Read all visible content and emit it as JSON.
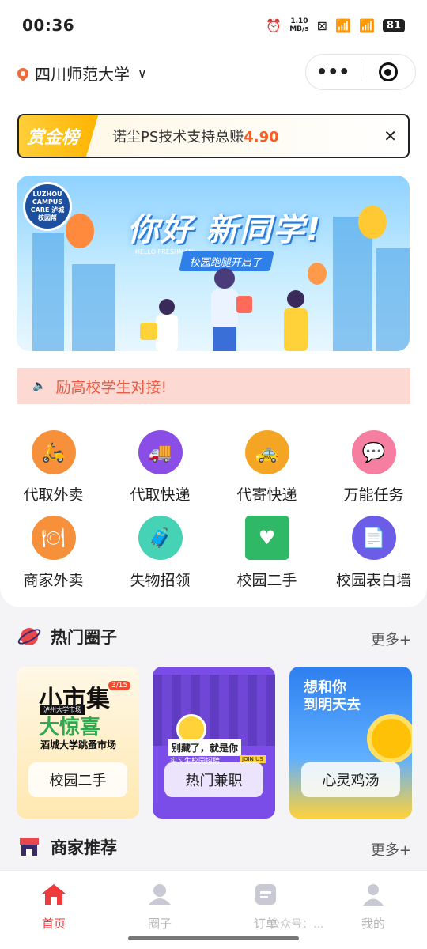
{
  "status": {
    "time": "00:36",
    "speed": "1.10\nMB/s",
    "speed_top": "1.10",
    "speed_bottom": "MB/s",
    "battery": "81"
  },
  "header": {
    "school": "四川师范大学"
  },
  "bounty": {
    "tag": "赏金榜",
    "text": "诺尘PS技术支持总赚",
    "amount": "4.90"
  },
  "banner": {
    "title": "你好 新同学!",
    "subtitle": "校园跑腿开启了",
    "hello": "HELLO FRESHMAN!",
    "logo": "LUZHOU CAMPUS CARE 泸城校园帮"
  },
  "notice": {
    "text": "励高校学生对接!"
  },
  "services": [
    {
      "label": "代取外卖",
      "icon": "takeout-icon",
      "color": "#f7903a"
    },
    {
      "label": "代取快递",
      "icon": "truck-icon",
      "color": "#8a4ee6"
    },
    {
      "label": "代寄快递",
      "icon": "taxi-icon",
      "color": "#f5a524"
    },
    {
      "label": "万能任务",
      "icon": "chat-bubble-icon",
      "color": "#f57ea1"
    },
    {
      "label": "商家外卖",
      "icon": "cloche-icon",
      "color": "#f7903a"
    },
    {
      "label": "失物招领",
      "icon": "luggage-icon",
      "color": "#46d2b4"
    },
    {
      "label": "校园二手",
      "icon": "gift-box-icon",
      "color": "#2fb866"
    },
    {
      "label": "校园表白墙",
      "icon": "note-icon",
      "color": "#6b5de8"
    }
  ],
  "hot": {
    "title": "热门圈子",
    "more": "更多+"
  },
  "circles": [
    {
      "label": "校园二手",
      "art_title": "小市集",
      "art_sub": "大惊喜",
      "art_tag": "3/15",
      "art_caption": "酒城大学跳蚤市场",
      "art_top": "泸州大学市场"
    },
    {
      "label": "热门兼职",
      "art_title": "别藏了，就是你",
      "art_sub": "实习生校园招聘",
      "art_tag": "JOIN US"
    },
    {
      "label": "心灵鸡汤",
      "art_title": "想和你",
      "art_sub": "到明天去"
    }
  ],
  "merchants": {
    "title": "商家推荐",
    "more": "更多+"
  },
  "nav": [
    {
      "label": "首页",
      "icon": "home-icon",
      "active": true
    },
    {
      "label": "圈子",
      "icon": "community-icon",
      "active": false
    },
    {
      "label": "订单",
      "icon": "order-icon",
      "active": false
    },
    {
      "label": "我的",
      "icon": "profile-icon",
      "active": false
    }
  ],
  "watermark": "公众号：..."
}
